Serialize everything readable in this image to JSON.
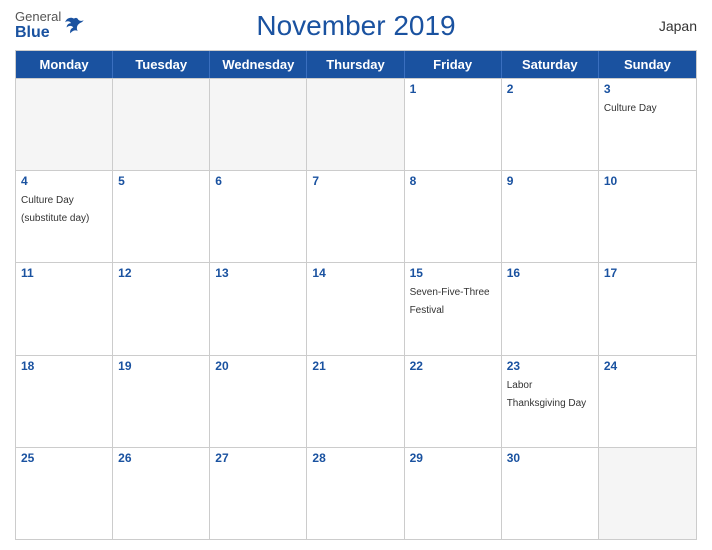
{
  "logo": {
    "general": "General",
    "blue": "Blue"
  },
  "title": "November 2019",
  "country": "Japan",
  "days_of_week": [
    "Monday",
    "Tuesday",
    "Wednesday",
    "Thursday",
    "Friday",
    "Saturday",
    "Sunday"
  ],
  "weeks": [
    [
      {
        "day": "",
        "empty": true
      },
      {
        "day": "",
        "empty": true
      },
      {
        "day": "",
        "empty": true
      },
      {
        "day": "",
        "empty": true
      },
      {
        "day": "1",
        "empty": false,
        "event": ""
      },
      {
        "day": "2",
        "empty": false,
        "event": ""
      },
      {
        "day": "3",
        "empty": false,
        "event": "Culture Day"
      }
    ],
    [
      {
        "day": "4",
        "empty": false,
        "event": "Culture Day (substitute day)"
      },
      {
        "day": "5",
        "empty": false,
        "event": ""
      },
      {
        "day": "6",
        "empty": false,
        "event": ""
      },
      {
        "day": "7",
        "empty": false,
        "event": ""
      },
      {
        "day": "8",
        "empty": false,
        "event": ""
      },
      {
        "day": "9",
        "empty": false,
        "event": ""
      },
      {
        "day": "10",
        "empty": false,
        "event": ""
      }
    ],
    [
      {
        "day": "11",
        "empty": false,
        "event": ""
      },
      {
        "day": "12",
        "empty": false,
        "event": ""
      },
      {
        "day": "13",
        "empty": false,
        "event": ""
      },
      {
        "day": "14",
        "empty": false,
        "event": ""
      },
      {
        "day": "15",
        "empty": false,
        "event": "Seven-Five-Three Festival"
      },
      {
        "day": "16",
        "empty": false,
        "event": ""
      },
      {
        "day": "17",
        "empty": false,
        "event": ""
      }
    ],
    [
      {
        "day": "18",
        "empty": false,
        "event": ""
      },
      {
        "day": "19",
        "empty": false,
        "event": ""
      },
      {
        "day": "20",
        "empty": false,
        "event": ""
      },
      {
        "day": "21",
        "empty": false,
        "event": ""
      },
      {
        "day": "22",
        "empty": false,
        "event": ""
      },
      {
        "day": "23",
        "empty": false,
        "event": "Labor Thanksgiving Day"
      },
      {
        "day": "24",
        "empty": false,
        "event": ""
      }
    ],
    [
      {
        "day": "25",
        "empty": false,
        "event": ""
      },
      {
        "day": "26",
        "empty": false,
        "event": ""
      },
      {
        "day": "27",
        "empty": false,
        "event": ""
      },
      {
        "day": "28",
        "empty": false,
        "event": ""
      },
      {
        "day": "29",
        "empty": false,
        "event": ""
      },
      {
        "day": "30",
        "empty": false,
        "event": ""
      },
      {
        "day": "",
        "empty": true
      }
    ]
  ],
  "colors": {
    "primary_blue": "#1a52a0",
    "header_bg": "#1a52a0",
    "empty_bg": "#f5f5f5"
  }
}
